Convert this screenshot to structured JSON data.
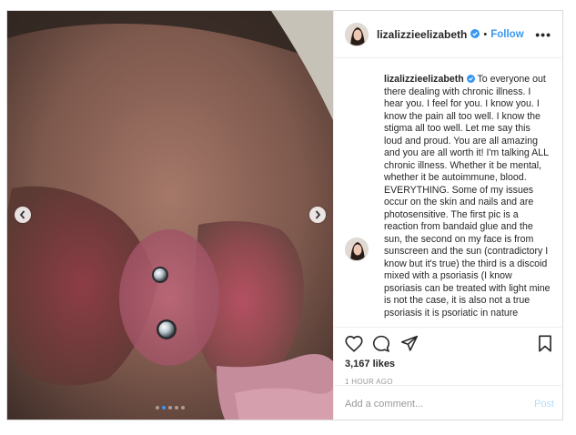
{
  "post": {
    "username": "lizalizzieelizabeth",
    "follow_label": "Follow",
    "separator": "•",
    "more_label": "•••",
    "caption_username": "lizalizzieelizabeth",
    "caption_text": "To everyone out there dealing with chronic illness. I hear you. I feel for you. I know you. I know the pain all too well. I know the stigma all too well. Let me say this loud and proud. You are all amazing and you are all worth it! I'm talking ALL chronic illness. Whether it be mental, whether it be autoimmune, blood. EVERYTHING. Some of my issues occur on the skin and nails and are photosensitive. The first pic is a reaction from bandaid glue and the sun, the second on my face is from sunscreen and the sun (contradictory I know but it's true) the third is a discoid mixed with a psoriasis (I know psoriasis can be treated with light mine is not the case, it is also not a true psoriasis it is psoriatic in nature",
    "likes": "3,167 likes",
    "timestamp": "1 HOUR AGO",
    "comment_placeholder": "Add a comment...",
    "post_button": "Post"
  },
  "carousel": {
    "total": 5,
    "active_index": 1
  },
  "icons": {
    "like": "heart-icon",
    "comment": "comment-icon",
    "share": "share-icon",
    "save": "bookmark-icon",
    "verified": "verified-badge-icon",
    "prev": "chevron-left-icon",
    "next": "chevron-right-icon"
  },
  "colors": {
    "link": "#3897f0",
    "post_disabled": "#b2dffc",
    "border": "#efefef"
  }
}
